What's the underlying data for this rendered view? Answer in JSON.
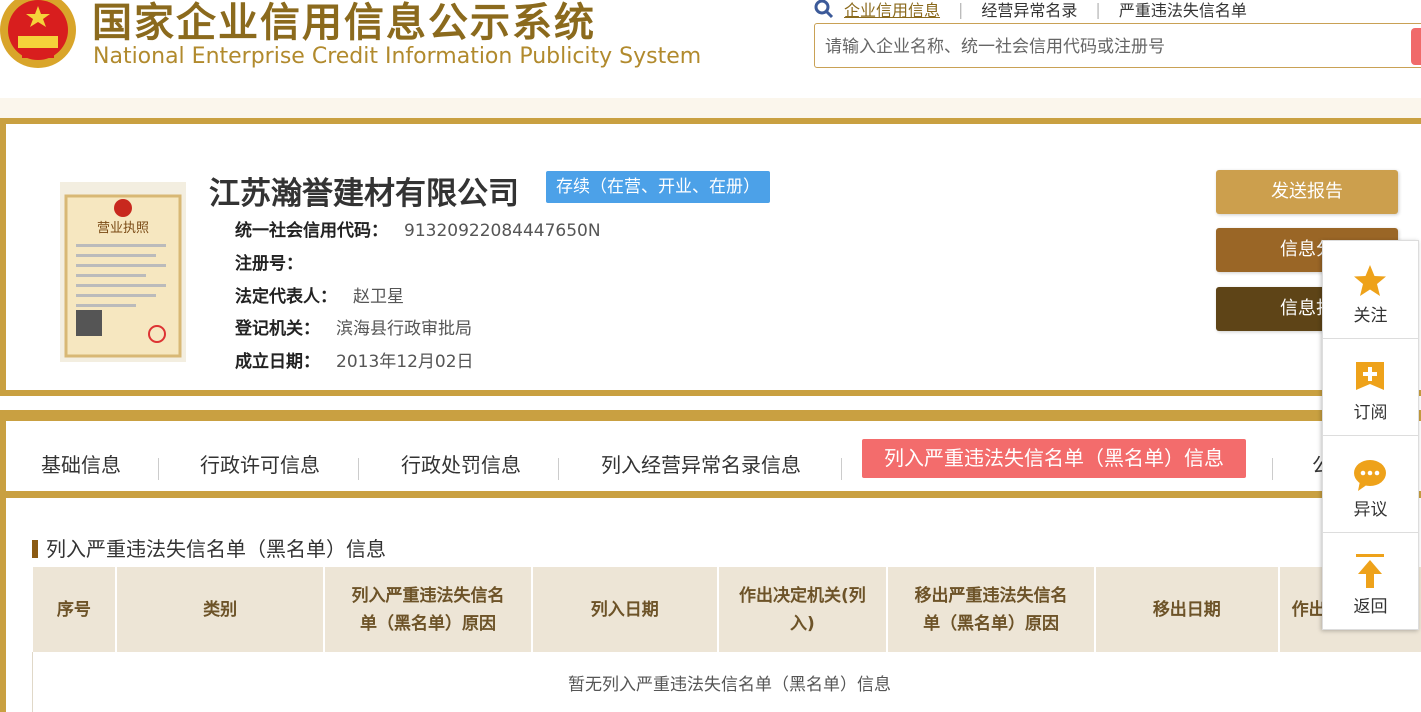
{
  "header": {
    "logo_cn": "国家企业信用信息公示系统",
    "logo_en": "National Enterprise Credit Information Publicity System",
    "nav": [
      "企业信用信息",
      "经营异常名录",
      "严重违法失信名单"
    ],
    "search_placeholder": "请输入企业名称、统一社会信用代码或注册号"
  },
  "company": {
    "name": "江苏瀚誉建材有限公司",
    "status": "存续（在营、开业、在册）",
    "fields": [
      {
        "label": "统一社会信用代码：",
        "value": "91320922084447650N"
      },
      {
        "label": "注册号：",
        "value": ""
      },
      {
        "label": "法定代表人：",
        "value": "赵卫星"
      },
      {
        "label": "登记机关：",
        "value": "滨海县行政审批局"
      },
      {
        "label": "成立日期：",
        "value": "2013年12月02日"
      }
    ],
    "license_title": "营业执照"
  },
  "actions": [
    "发送报告",
    "信息分",
    "信息打"
  ],
  "tabs": [
    "基础信息",
    "行政许可信息",
    "行政处罚信息",
    "列入经营异常名录信息",
    "列入严重违法失信名单（黑名单）信息",
    "公"
  ],
  "section": {
    "title": "列入严重违法失信名单（黑名单）信息",
    "columns": [
      [
        "序号"
      ],
      [
        "类别"
      ],
      [
        "列入严重违法失信名",
        "单（黑名单）原因"
      ],
      [
        "列入日期"
      ],
      [
        "作出决定机关(列",
        "入)"
      ],
      [
        "移出严重违法失信名",
        "单（黑名单）原因"
      ],
      [
        "移出日期"
      ],
      [
        "作出决"
      ]
    ],
    "empty_text": "暂无列入严重违法失信名单（黑名单）信息"
  },
  "side": [
    "关注",
    "订阅",
    "异议",
    "返回"
  ],
  "colors": {
    "gold": "#c9a041",
    "brown": "#8b6a1d",
    "status_blue": "#4ca1e8",
    "active_tab": "#f36c6c"
  }
}
